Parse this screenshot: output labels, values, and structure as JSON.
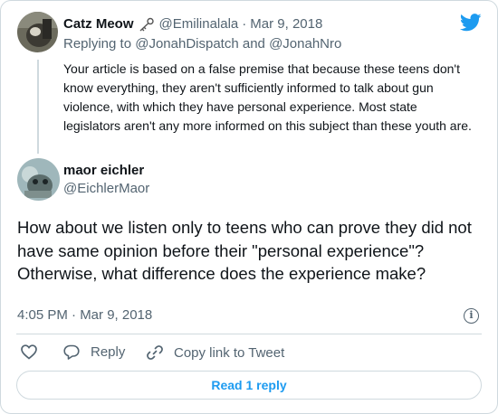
{
  "colors": {
    "brand": "#1d9bf0",
    "muted": "#536471",
    "text": "#0f1419",
    "border": "#cfd9de"
  },
  "parent": {
    "name": "Catz Meow",
    "handle": "@Emilinalala",
    "separator": "·",
    "date": "Mar 9, 2018",
    "replying_prefix": "Replying to",
    "replying_to_1": "@JonahDispatch",
    "replying_and": "and",
    "replying_to_2": "@JonahNro",
    "text": "Your article is based on a false premise that because these teens don't know everything, they aren't sufficiently informed to talk about gun violence, with which they have personal experience.  Most state legislators aren't any more informed on this subject than these youth are."
  },
  "main": {
    "name": "maor eichler",
    "handle": "@EichlerMaor",
    "text": "How about we listen only to teens who can prove they did not have same opinion before their \"personal experience\"? Otherwise, what difference does the experience make?",
    "timestamp": "4:05 PM · Mar 9, 2018"
  },
  "actions": {
    "reply_label": "Reply",
    "copy_link_label": "Copy link to Tweet",
    "read_reply_label": "Read 1 reply"
  },
  "icons": [
    "twitter-bird-icon",
    "key-icon",
    "heart-icon",
    "reply-icon",
    "link-icon",
    "info-icon"
  ]
}
